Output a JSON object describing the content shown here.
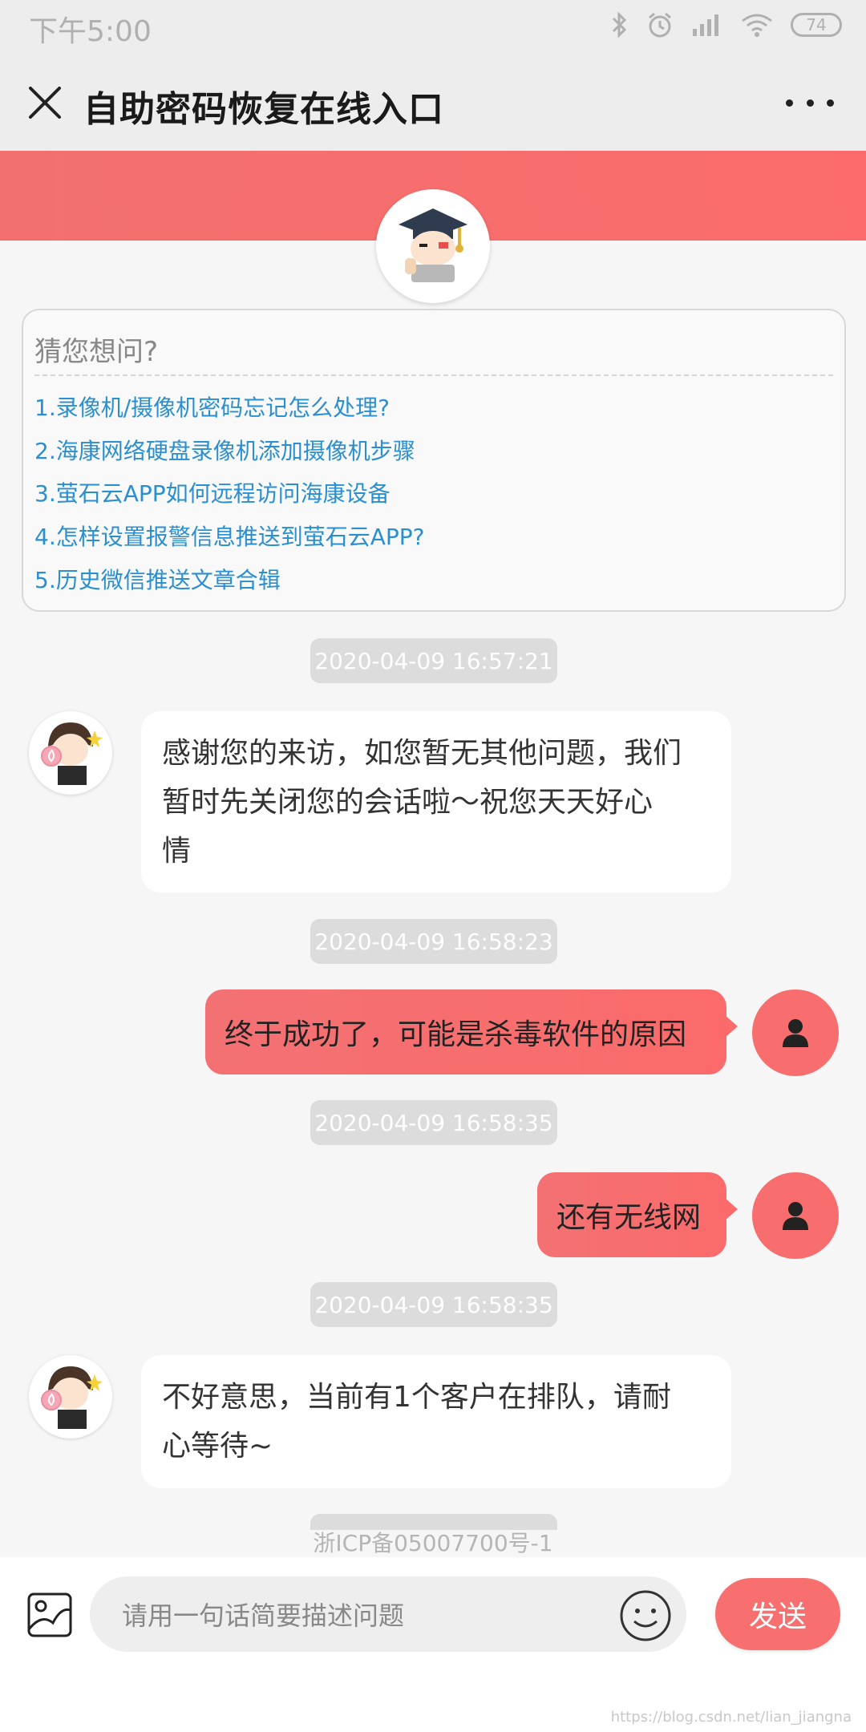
{
  "status_bar": {
    "time": "下午5:00",
    "battery": "74"
  },
  "header": {
    "title": "自助密码恢复在线入口"
  },
  "faq": {
    "heading": "猜您想问?",
    "items": [
      "1.录像机/摄像机密码忘记怎么处理?",
      "2.海康网络硬盘录像机添加摄像机步骤",
      "3.萤石云APP如何远程访问海康设备",
      "4.怎样设置报警信息推送到萤石云APP?",
      "5.历史微信推送文章合辑"
    ]
  },
  "messages": [
    {
      "timestamp": "2020-04-09 16:57:21",
      "from": "agent",
      "lines": [
        "感谢您的来访，如您暂无其他问题，我们",
        "暂时先关闭您的会话啦～祝您天天好心",
        "情"
      ]
    },
    {
      "timestamp": "2020-04-09 16:58:23",
      "from": "user",
      "text": "终于成功了，可能是杀毒软件的原因"
    },
    {
      "timestamp": "2020-04-09 16:58:35",
      "from": "user",
      "text": "还有无线网"
    },
    {
      "timestamp": "2020-04-09 16:58:35",
      "from": "agent",
      "lines": [
        "不好意思，当前有1个客户在排队，请耐",
        "心等待~"
      ]
    }
  ],
  "footer": {
    "icp": "浙ICP备05007700号-1"
  },
  "input_bar": {
    "placeholder": "请用一句话简要描述问题",
    "send_label": "发送"
  },
  "watermark": "https://blog.csdn.net/lian_jiangna",
  "colors": {
    "accent": "#f86f6f",
    "link": "#2a8fd0",
    "timestamp_bg": "#dcdcdc"
  },
  "icons": [
    "close-icon",
    "more-icon",
    "image-icon",
    "emoji-icon",
    "user-icon",
    "bluetooth-icon",
    "alarm-icon",
    "signal-icon",
    "wifi-icon"
  ]
}
